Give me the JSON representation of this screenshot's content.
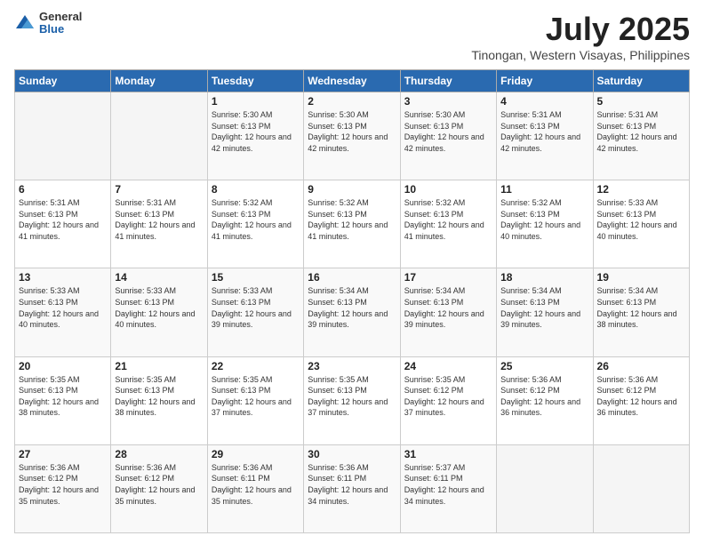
{
  "logo": {
    "general": "General",
    "blue": "Blue"
  },
  "header": {
    "title": "July 2025",
    "subtitle": "Tinongan, Western Visayas, Philippines"
  },
  "days_of_week": [
    "Sunday",
    "Monday",
    "Tuesday",
    "Wednesday",
    "Thursday",
    "Friday",
    "Saturday"
  ],
  "weeks": [
    [
      {
        "day": "",
        "info": ""
      },
      {
        "day": "",
        "info": ""
      },
      {
        "day": "1",
        "info": "Sunrise: 5:30 AM\nSunset: 6:13 PM\nDaylight: 12 hours and 42 minutes."
      },
      {
        "day": "2",
        "info": "Sunrise: 5:30 AM\nSunset: 6:13 PM\nDaylight: 12 hours and 42 minutes."
      },
      {
        "day": "3",
        "info": "Sunrise: 5:30 AM\nSunset: 6:13 PM\nDaylight: 12 hours and 42 minutes."
      },
      {
        "day": "4",
        "info": "Sunrise: 5:31 AM\nSunset: 6:13 PM\nDaylight: 12 hours and 42 minutes."
      },
      {
        "day": "5",
        "info": "Sunrise: 5:31 AM\nSunset: 6:13 PM\nDaylight: 12 hours and 42 minutes."
      }
    ],
    [
      {
        "day": "6",
        "info": "Sunrise: 5:31 AM\nSunset: 6:13 PM\nDaylight: 12 hours and 41 minutes."
      },
      {
        "day": "7",
        "info": "Sunrise: 5:31 AM\nSunset: 6:13 PM\nDaylight: 12 hours and 41 minutes."
      },
      {
        "day": "8",
        "info": "Sunrise: 5:32 AM\nSunset: 6:13 PM\nDaylight: 12 hours and 41 minutes."
      },
      {
        "day": "9",
        "info": "Sunrise: 5:32 AM\nSunset: 6:13 PM\nDaylight: 12 hours and 41 minutes."
      },
      {
        "day": "10",
        "info": "Sunrise: 5:32 AM\nSunset: 6:13 PM\nDaylight: 12 hours and 41 minutes."
      },
      {
        "day": "11",
        "info": "Sunrise: 5:32 AM\nSunset: 6:13 PM\nDaylight: 12 hours and 40 minutes."
      },
      {
        "day": "12",
        "info": "Sunrise: 5:33 AM\nSunset: 6:13 PM\nDaylight: 12 hours and 40 minutes."
      }
    ],
    [
      {
        "day": "13",
        "info": "Sunrise: 5:33 AM\nSunset: 6:13 PM\nDaylight: 12 hours and 40 minutes."
      },
      {
        "day": "14",
        "info": "Sunrise: 5:33 AM\nSunset: 6:13 PM\nDaylight: 12 hours and 40 minutes."
      },
      {
        "day": "15",
        "info": "Sunrise: 5:33 AM\nSunset: 6:13 PM\nDaylight: 12 hours and 39 minutes."
      },
      {
        "day": "16",
        "info": "Sunrise: 5:34 AM\nSunset: 6:13 PM\nDaylight: 12 hours and 39 minutes."
      },
      {
        "day": "17",
        "info": "Sunrise: 5:34 AM\nSunset: 6:13 PM\nDaylight: 12 hours and 39 minutes."
      },
      {
        "day": "18",
        "info": "Sunrise: 5:34 AM\nSunset: 6:13 PM\nDaylight: 12 hours and 39 minutes."
      },
      {
        "day": "19",
        "info": "Sunrise: 5:34 AM\nSunset: 6:13 PM\nDaylight: 12 hours and 38 minutes."
      }
    ],
    [
      {
        "day": "20",
        "info": "Sunrise: 5:35 AM\nSunset: 6:13 PM\nDaylight: 12 hours and 38 minutes."
      },
      {
        "day": "21",
        "info": "Sunrise: 5:35 AM\nSunset: 6:13 PM\nDaylight: 12 hours and 38 minutes."
      },
      {
        "day": "22",
        "info": "Sunrise: 5:35 AM\nSunset: 6:13 PM\nDaylight: 12 hours and 37 minutes."
      },
      {
        "day": "23",
        "info": "Sunrise: 5:35 AM\nSunset: 6:13 PM\nDaylight: 12 hours and 37 minutes."
      },
      {
        "day": "24",
        "info": "Sunrise: 5:35 AM\nSunset: 6:12 PM\nDaylight: 12 hours and 37 minutes."
      },
      {
        "day": "25",
        "info": "Sunrise: 5:36 AM\nSunset: 6:12 PM\nDaylight: 12 hours and 36 minutes."
      },
      {
        "day": "26",
        "info": "Sunrise: 5:36 AM\nSunset: 6:12 PM\nDaylight: 12 hours and 36 minutes."
      }
    ],
    [
      {
        "day": "27",
        "info": "Sunrise: 5:36 AM\nSunset: 6:12 PM\nDaylight: 12 hours and 35 minutes."
      },
      {
        "day": "28",
        "info": "Sunrise: 5:36 AM\nSunset: 6:12 PM\nDaylight: 12 hours and 35 minutes."
      },
      {
        "day": "29",
        "info": "Sunrise: 5:36 AM\nSunset: 6:11 PM\nDaylight: 12 hours and 35 minutes."
      },
      {
        "day": "30",
        "info": "Sunrise: 5:36 AM\nSunset: 6:11 PM\nDaylight: 12 hours and 34 minutes."
      },
      {
        "day": "31",
        "info": "Sunrise: 5:37 AM\nSunset: 6:11 PM\nDaylight: 12 hours and 34 minutes."
      },
      {
        "day": "",
        "info": ""
      },
      {
        "day": "",
        "info": ""
      }
    ]
  ]
}
